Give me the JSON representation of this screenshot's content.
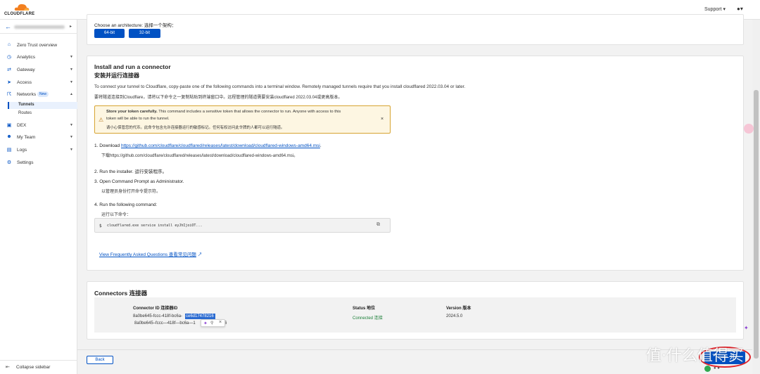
{
  "topbar": {
    "brand": "CLOUDFLARE",
    "support": "Support ▾",
    "user_icon": "user-icon"
  },
  "sidebar": {
    "items": [
      {
        "label": "Zero Trust overview",
        "icon": "home-icon"
      },
      {
        "label": "Analytics",
        "icon": "clock-icon"
      },
      {
        "label": "Gateway",
        "icon": "gateway-icon"
      },
      {
        "label": "Access",
        "icon": "access-icon"
      },
      {
        "label": "Networks",
        "icon": "network-icon",
        "badge": "New"
      },
      {
        "label": "DEX",
        "icon": "dex-icon"
      },
      {
        "label": "My Team",
        "icon": "team-icon"
      },
      {
        "label": "Logs",
        "icon": "logs-icon"
      },
      {
        "label": "Settings",
        "icon": "gear-icon"
      }
    ],
    "subitems": [
      "Tunnels",
      "Routes"
    ],
    "collapse": "Collapse sidebar"
  },
  "arch": {
    "label": "Choose an architecture: 选择一个架构：",
    "btn64": "64-bit",
    "btn32": "32-bit"
  },
  "install": {
    "title": "Install and run a connector",
    "title_cn": "安装并运行连接器",
    "desc": "To connect your tunnel to Cloudflare, copy-paste one of the following commands into a terminal window. Remotely managed tunnels require that you install cloudflared 2022.03.04 or later.",
    "desc_cn": "要将隧道连接到Cloudflare，请将以下命令之一复制粘贴到终端窗口中。远程管理的隧道需要安装cloudflared 2022.03.04或更高版本。",
    "warn_bold": "Store your token carefully.",
    "warn_text": " This command includes a sensitive token that allows the connector to run. Anyone with access to this",
    "warn_text2": "token will be able to run the tunnel.",
    "warn_cn": "请小心保管您的代币。此命令包含允许连接器运行的敏感标记。任何有权访问此令牌的人都可以运行隧道。",
    "step1": "1. Download ",
    "step1_link": "https://github.com/cloudflare/cloudflared/releases/latest/download/cloudflared-windows-amd64.msi",
    "step1_end": ".",
    "step1_cn": "下载https://github.com/cloudflare/cloudflared/releases/latest/download/cloudflared-windows-amd64.msi。",
    "step2": "2. Run the installer.  运行安装程序。",
    "step3": "3. Open Command Prompt as Administrator.",
    "step3_cn": "以管理员身份打开命令提示符。",
    "step4": "4. Run the following command:",
    "step4_cn": "运行以下命令：",
    "cmd_prompt": "$",
    "cmd": "cloudflared.exe service install eyJhIjoiOT...",
    "faq": "View Frequently Asked Questions 查看常见问题"
  },
  "connectors": {
    "title": "Connectors 连接器",
    "headers": [
      "Connector ID 连接器ID",
      "Status 地位",
      "Version 版本"
    ],
    "id_prefix": "8a0be645-fccc-418f-bc6a-",
    "id_selected": "ce6d17478216",
    "id_line2": "8a0be645–fccc—418f—bc6a—1",
    "id_tail": "6",
    "status": "Connected 连接",
    "version": "2024.5.0"
  },
  "footer": {
    "back": "Back",
    "next": "下一步",
    "watermark": "值·什么值得买"
  },
  "colors": {
    "accent": "#0051c3",
    "connected": "#1a7f37",
    "warn_border": "#d7a431",
    "annotation": "#e0242b"
  }
}
